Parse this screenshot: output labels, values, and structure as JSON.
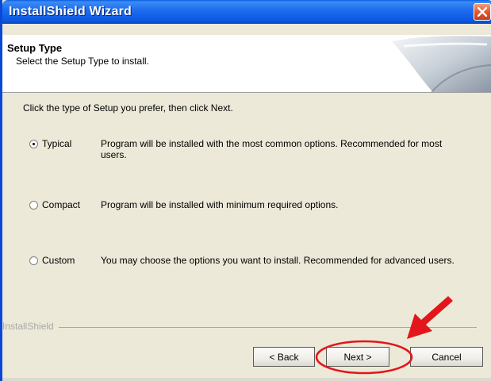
{
  "window": {
    "title": "InstallShield Wizard"
  },
  "header": {
    "title": "Setup Type",
    "subtitle": "Select the Setup Type to install."
  },
  "body": {
    "instruction": "Click the type of Setup you prefer, then click Next.",
    "options": [
      {
        "label": "Typical",
        "description": "Program will be installed with the most common options.  Recommended for most users.",
        "selected": true
      },
      {
        "label": "Compact",
        "description": "Program will be installed with minimum required options.",
        "selected": false
      },
      {
        "label": "Custom",
        "description": "You may choose the options you want to install. Recommended for advanced users.",
        "selected": false
      }
    ]
  },
  "footer": {
    "brand": "InstallShield"
  },
  "buttons": {
    "back": "< Back",
    "next": "Next >",
    "cancel": "Cancel"
  },
  "annotations": {
    "highlight_color": "#e3161b"
  }
}
